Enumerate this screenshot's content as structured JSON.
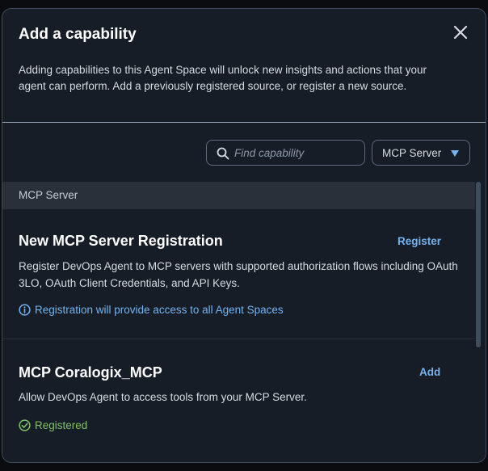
{
  "modal": {
    "title": "Add a capability",
    "close_icon": "close-icon",
    "description": "Adding capabilities to this Agent Space will unlock new insights and actions that your agent can perform. Add a previously registered source, or register a new source."
  },
  "filters": {
    "search_placeholder": "Find capability",
    "search_value": "",
    "search_icon": "search-icon",
    "type_select": "MCP Server",
    "type_select_icon": "caret-down-icon"
  },
  "group": {
    "label": "MCP Server"
  },
  "cards": [
    {
      "name": "New MCP Server Registration",
      "action": "Register",
      "description": "Register DevOps Agent to MCP servers with supported authorization flows including OAuth 3LO, OAuth Client Credentials, and API Keys.",
      "note": "Registration will provide access to all Agent Spaces",
      "note_icon": "info-icon"
    },
    {
      "name": "MCP Coralogix_MCP",
      "action": "Add",
      "description": "Allow DevOps Agent to access tools from your MCP Server.",
      "status": "Registered",
      "status_icon": "check-circle-icon"
    }
  ],
  "colors": {
    "background": "#161d26",
    "link": "#75b3f0",
    "success": "#7fc46a",
    "group_header": "#2a3039"
  }
}
